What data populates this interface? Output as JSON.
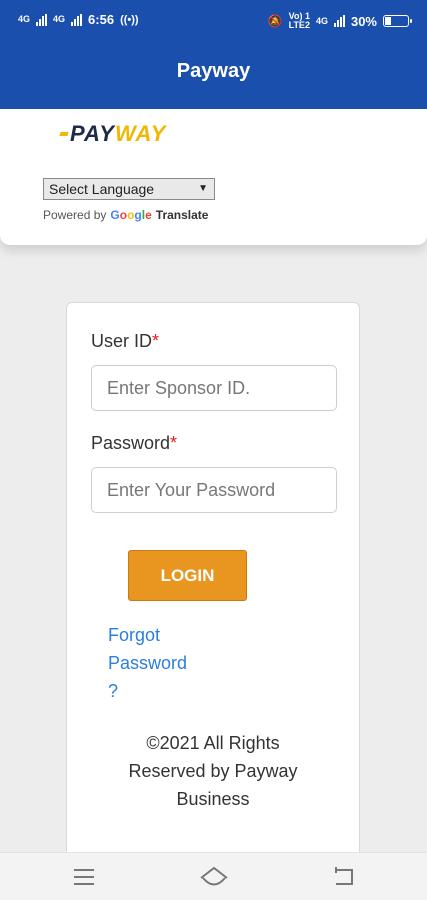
{
  "status_bar": {
    "signal_left": "4G",
    "signal_right": "4G",
    "time": "6:56",
    "volte_top": "Vo) 1",
    "volte_bottom": "LTE2",
    "net_right": "4G",
    "battery": "30%",
    "battery_level": 0.3
  },
  "app_bar": {
    "title": "Payway"
  },
  "header": {
    "logo": {
      "part1": "PAY",
      "part2": "WAY"
    },
    "language_select": {
      "selected": "Select Language"
    },
    "powered_by": "Powered by",
    "google": [
      "G",
      "o",
      "o",
      "g",
      "l",
      "e"
    ],
    "translate": "Translate"
  },
  "login": {
    "user_id": {
      "label": "User ID",
      "required": "*",
      "placeholder": "Enter Sponsor ID."
    },
    "password": {
      "label": "Password",
      "required": "*",
      "placeholder": "Enter Your Password"
    },
    "login_button": "LOGIN",
    "forgot_line1": "Forgot",
    "forgot_line2": "Password",
    "forgot_line3": "?",
    "copyright_line1": "©2021 All Rights",
    "copyright_line2": "Reserved by Payway",
    "copyright_line3": "Business"
  },
  "colors": {
    "appbar": "#1a4fae",
    "login_button": "#e8961f",
    "link": "#2b7fe0",
    "required": "#e02020"
  },
  "navigation": {
    "icons": [
      "menu-icon",
      "home-icon",
      "back-icon"
    ]
  }
}
